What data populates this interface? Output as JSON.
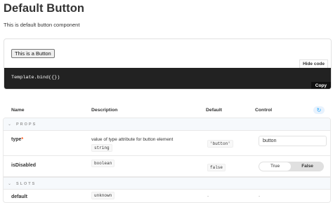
{
  "page": {
    "title": "Default Button",
    "subtitle": "This is default button component"
  },
  "preview": {
    "demo_button_label": "This is a Button",
    "hide_code_label": "Hide code",
    "code": "Template.bind({})",
    "copy_label": "Copy"
  },
  "table": {
    "headers": {
      "name": "Name",
      "description": "Description",
      "default": "Default",
      "control": "Control"
    },
    "reset_icon": "reset-icon",
    "sections": {
      "props": "PROPS",
      "slots": "SLOTS"
    },
    "rows": {
      "type": {
        "name": "type",
        "required_mark": "*",
        "description": "value of type attribute for button element",
        "type": "string",
        "default": "'button'",
        "control_value": "button"
      },
      "isDisabled": {
        "name": "isDisabled",
        "type": "boolean",
        "default": "false",
        "toggle_true": "True",
        "toggle_false": "False",
        "selected": "False"
      },
      "default": {
        "name": "default",
        "type": "unknown",
        "default": "-",
        "control": "-"
      }
    }
  },
  "colors": {
    "accent": "#1ea7fd",
    "required": "#ff4400",
    "code_bg": "#222222"
  }
}
